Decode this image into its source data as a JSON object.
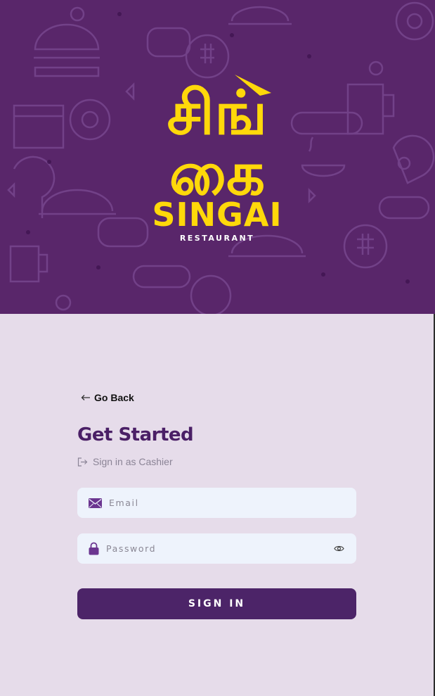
{
  "brand": {
    "tamil_line1": "சிங்",
    "tamil_line2": "கை",
    "name": "SINGAI",
    "tagline": "RESTAURANT"
  },
  "nav": {
    "back_label": "Go Back"
  },
  "form": {
    "title": "Get Started",
    "subtitle": "Sign in as Cashier",
    "email": {
      "value": "",
      "placeholder": "Email"
    },
    "password": {
      "value": "",
      "placeholder": "Password"
    },
    "submit_label": "SIGN IN"
  },
  "icons": {
    "back": "arrow-left-icon",
    "subtitle": "sign-in-icon",
    "email": "envelope-icon",
    "password": "lock-icon",
    "toggle": "eye-icon"
  },
  "colors": {
    "hero_bg": "#59266a",
    "page_bg": "#e6dcea",
    "brand_yellow": "#ffd80a",
    "primary": "#4c2468",
    "title": "#4a1f66",
    "input_bg": "#eef3fc"
  }
}
